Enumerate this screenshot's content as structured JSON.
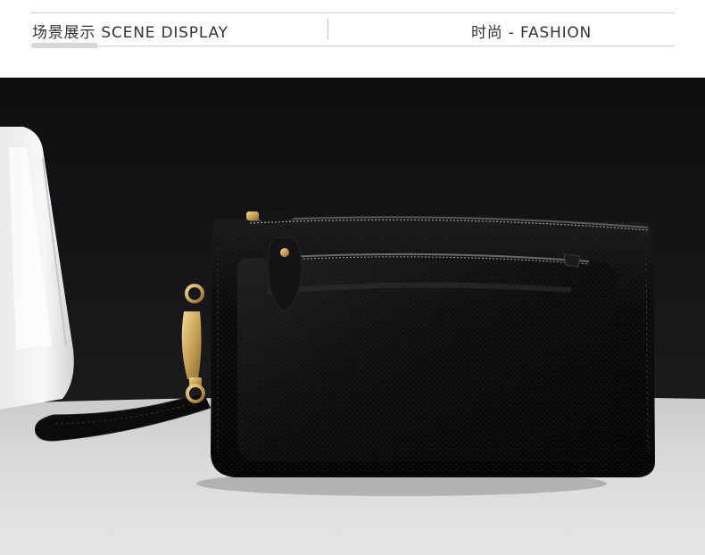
{
  "header": {
    "left_title": "场景展示 SCENE DISPLAY",
    "right_title": "时尚 - FASHION"
  },
  "photo": {
    "subject": "black leather wristlet clutch bag",
    "colors": {
      "backdrop": "#151517",
      "table": "#d9dadc",
      "leather": "#0b0b0c",
      "hardware": "#c9a45a"
    }
  }
}
